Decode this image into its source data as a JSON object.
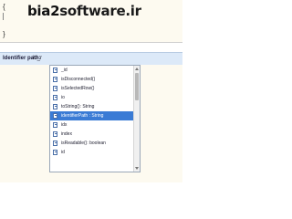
{
  "editor": {
    "brace_open": "{",
    "brace_close": "}"
  },
  "watermark": {
    "text_a": "bia2",
    "text_b": "software.ir"
  },
  "evaluation": {
    "label": "Identifier path:",
    "input_value": "id_r"
  },
  "completion": {
    "items": [
      {
        "label": "_id",
        "selected": false
      },
      {
        "label": "isDisconnected()",
        "selected": false
      },
      {
        "label": "isSelectedRow()",
        "selected": false
      },
      {
        "label": "io",
        "selected": false
      },
      {
        "label": "toString(): String",
        "selected": false
      },
      {
        "label": "identifierPath : String",
        "selected": true
      },
      {
        "label": "idx",
        "selected": false
      },
      {
        "label": "index",
        "selected": false
      },
      {
        "label": "isReadable(): boolean",
        "selected": false
      },
      {
        "label": "id",
        "selected": false
      }
    ]
  }
}
